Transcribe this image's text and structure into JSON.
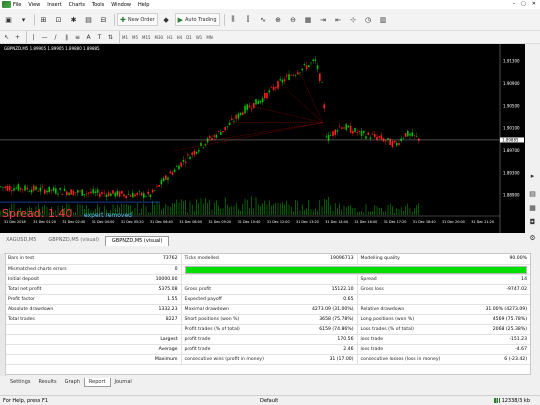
{
  "menu": {
    "items": [
      "File",
      "View",
      "Insert",
      "Charts",
      "Tools",
      "Window",
      "Help"
    ],
    "window_controls": [
      "–",
      "▢",
      "✕"
    ]
  },
  "toolbar": {
    "new_order_label": "New Order",
    "auto_trading_label": "Auto Trading",
    "timeframes": [
      "M1",
      "M5",
      "M15",
      "M30",
      "H1",
      "H4",
      "D1",
      "W1",
      "MN"
    ]
  },
  "chart": {
    "header": "GBPNZD,M5  1.89905 1.89905 1.89880 1.89885",
    "spread_text": "Spread: 1.40",
    "expert_text": "expert removed",
    "price_labels": [
      "1.91300",
      "1.90900",
      "1.90500",
      "1.90100",
      "1.89700",
      "1.89300",
      "1.88900"
    ],
    "current_price": "1.89885",
    "time_labels": [
      "31 Dec 2018",
      "31 Dec 01:20",
      "31 Dec 02:40",
      "31 Dec 04:00",
      "31 Dec 05:20",
      "31 Dec 06:40",
      "31 Dec 08:00",
      "31 Dec 09:20",
      "31 Dec 10:40",
      "31 Dec 12:00",
      "31 Dec 13:20",
      "31 Dec 14:40",
      "31 Dec 16:00",
      "31 Dec 17:20",
      "31 Dec 18:40",
      "31 Dec 20:00",
      "31 Dec 21:20"
    ],
    "colors": {
      "bull": "#00c000",
      "bear": "#ff2020",
      "line": "#ffffff",
      "trade_line": "#c00000",
      "price_line": "#c0c0c0"
    }
  },
  "chart_tabs": [
    "XAGUSD,M5",
    "GBPNZD,M5 (visual)",
    "GBPNZD,M5 (visual)"
  ],
  "report": {
    "bars_in_test_label": "Bars in test",
    "bars_in_test": "73762",
    "ticks_modelled_label": "Ticks modelled",
    "ticks_modelled": "19096713",
    "modelling_quality_label": "Modelling quality",
    "modelling_quality": "90.00%",
    "mismatched_label": "Mismatched charts errors",
    "mismatched": "0",
    "modelling_quality_fill": 1.0,
    "rows": [
      [
        "Initial deposit",
        "10000.00",
        "",
        "",
        "Spread",
        "14"
      ],
      [
        "Total net profit",
        "5375.08",
        "Gross profit",
        "15122.10",
        "Gross loss",
        "-9747.02"
      ],
      [
        "Profit factor",
        "1.55",
        "Expected payoff",
        "0.65",
        "",
        ""
      ],
      [
        "Absolute drawdown",
        "1332.23",
        "Maximal drawdown",
        "4273.09 (31.00%)",
        "Relative drawdown",
        "31.00% (4273.09)"
      ],
      [
        "Total trades",
        "8227",
        "Short positions (won %)",
        "3658 (75.78%)",
        "Long positions (won %)",
        "4569 (75.78%)"
      ],
      [
        "",
        "",
        "Profit trades (% of total)",
        "6159 (74.86%)",
        "Loss trades (% of total)",
        "2068 (25.38%)"
      ],
      [
        "",
        "Largest",
        "profit trade",
        "170.56",
        "loss trade",
        "-151.23"
      ],
      [
        "",
        "Average",
        "profit trade",
        "2.46",
        "loss trade",
        "-4.67"
      ],
      [
        "",
        "Maximum",
        "consecutive wins (profit in money)",
        "31 (17.00)",
        "consecutive losses (loss in money)",
        "6 (-23.42)"
      ]
    ]
  },
  "tester_tabs": [
    "Settings",
    "Results",
    "Graph",
    "Report",
    "Journal"
  ],
  "status": {
    "help_text": "For Help, press F1",
    "profile": "Default",
    "traffic": "12338/3 kb"
  }
}
